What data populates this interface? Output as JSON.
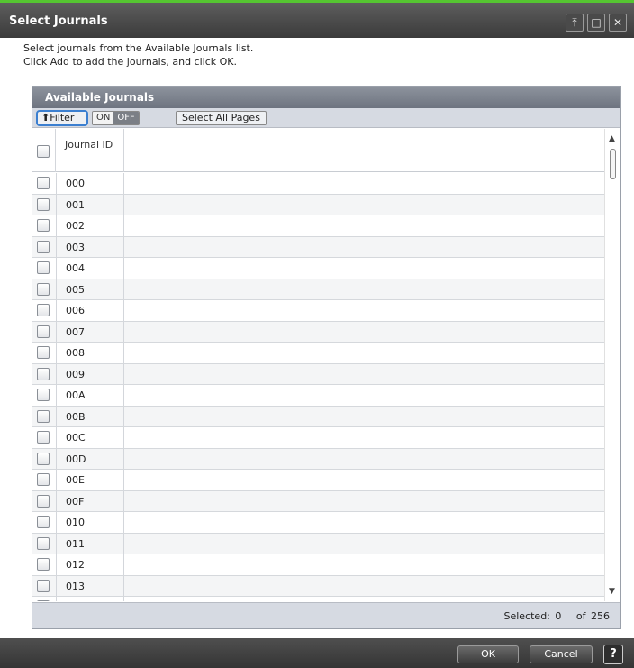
{
  "window": {
    "title": "Select Journals",
    "buttons": {
      "pin_icon": "pin-icon",
      "maximize_icon": "maximize-icon",
      "close_icon": "close-icon"
    }
  },
  "instructions": {
    "line1": "Select journals from the Available Journals list.",
    "line2": "Click Add to add the journals, and click OK."
  },
  "panel": {
    "title": "Available Journals",
    "filter_label": "⬆Filter",
    "filter_on": "ON",
    "filter_off": "OFF",
    "filter_state": "OFF",
    "select_all_label": "Select All Pages",
    "columns": {
      "journal_id": "Journal ID"
    },
    "rows": [
      "000",
      "001",
      "002",
      "003",
      "004",
      "005",
      "006",
      "007",
      "008",
      "009",
      "00A",
      "00B",
      "00C",
      "00D",
      "00E",
      "00F",
      "010",
      "011",
      "012",
      "013",
      ""
    ],
    "footer": {
      "selected_text": "Selected: 0",
      "of_text": "of 256"
    }
  },
  "bottom": {
    "ok_label": "OK",
    "cancel_label": "Cancel",
    "help_label": "?"
  },
  "colors": {
    "accent_green": "#55c531",
    "titlebar": "#3b3b3b",
    "filter_focus": "#3b7fd0"
  }
}
